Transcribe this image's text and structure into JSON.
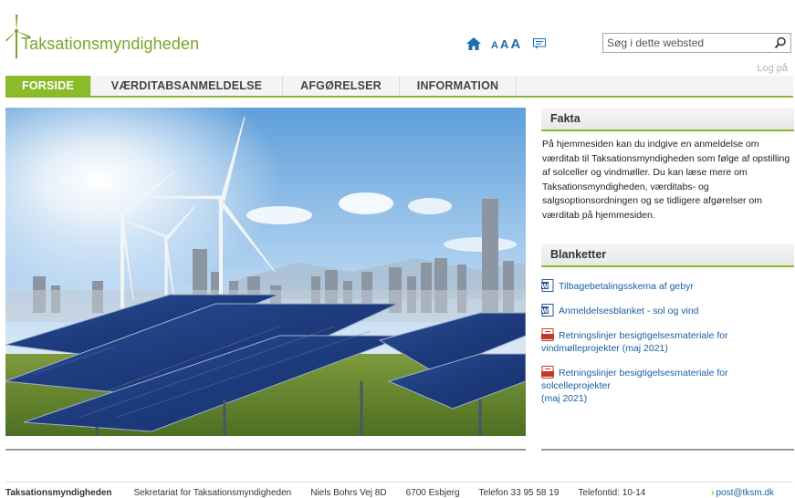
{
  "header": {
    "logo_text": "Taksationsmyndigheden",
    "search_placeholder": "Søg i dette websted",
    "font_sizes": [
      "A",
      "A",
      "A"
    ],
    "login": "Log på"
  },
  "nav": {
    "items": [
      {
        "label": "FORSIDE",
        "active": true
      },
      {
        "label": "VÆRDITABSANMELDELSE",
        "active": false
      },
      {
        "label": "AFGØRELSER",
        "active": false
      },
      {
        "label": "INFORMATION",
        "active": false
      }
    ]
  },
  "fakta": {
    "title": "Fakta",
    "text": "På hjemmesiden kan du indgive en anmeldelse om værditab til Taksationsmyndigheden som følge af opstilling af solceller og vindmøller. Du kan læse mere om Taksationsmyndigheden, værditabs- og salgsoptionsordningen og se tidligere afgørelser om værditab på hjemmesiden."
  },
  "blanketter": {
    "title": "Blanketter",
    "items": [
      {
        "icon": "word-doc-icon",
        "line1": "Tilbagebetalingsskema af gebyr",
        "line2": ""
      },
      {
        "icon": "word-doc-icon",
        "line1": "Anmeldelsesblanket - sol og vind",
        "line2": ""
      },
      {
        "icon": "pdf-doc-icon",
        "line1": "Retningslinjer besigtigelsesmateriale for",
        "line2": "vindmølleprojekter (maj 2021)"
      },
      {
        "icon": "pdf-doc-icon",
        "line1": "Retningslinjer besigtigelsesmateriale for solcelleprojekter",
        "line2": "(maj 2021)"
      }
    ]
  },
  "footer": {
    "org": "Taksationsmyndigheden",
    "secretariat": "Sekretariat for Taksationsmyndigheden",
    "address": "Niels Bohrs Vej 8D",
    "city": "6700 Esbjerg",
    "phone": "Telefon 33 95 58 19",
    "hours": "Telefontid: 10-14",
    "email": "post@tksm.dk"
  },
  "colors": {
    "accent": "#8bbb2a",
    "link": "#1a5ea3",
    "logo": "#7aa52a"
  }
}
